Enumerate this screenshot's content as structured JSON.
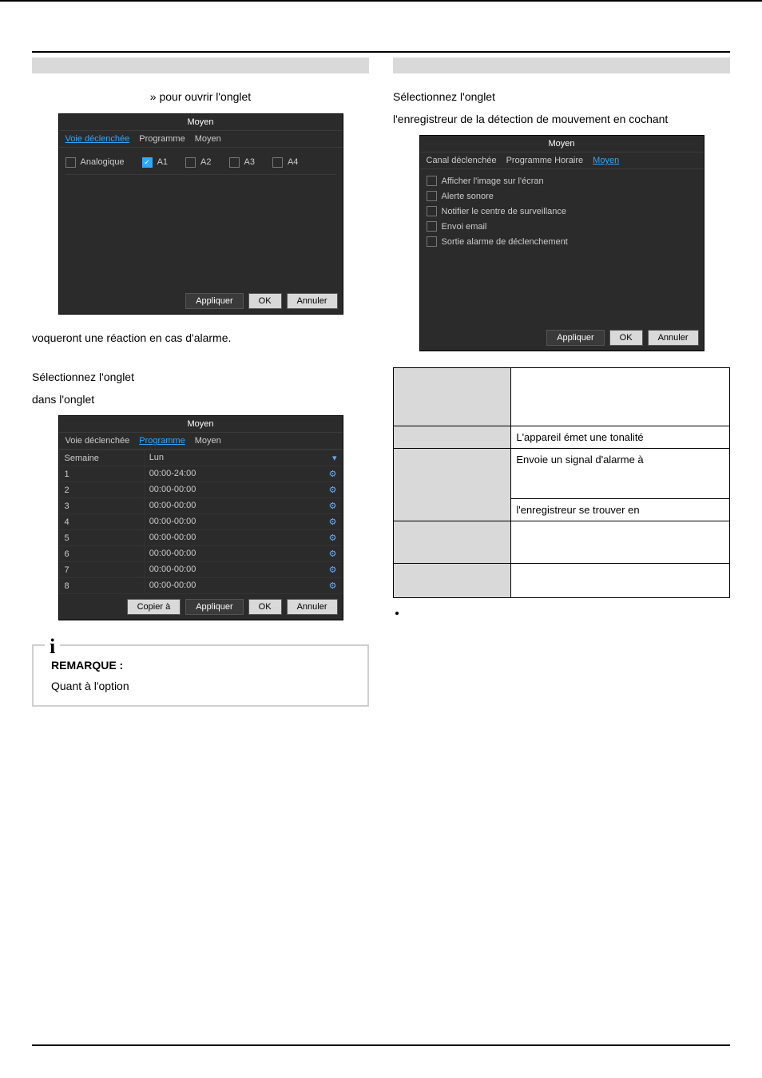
{
  "left": {
    "line1": "» pour ouvrir l'onglet",
    "fig1": {
      "title": "Moyen",
      "tabs": [
        "Voie déclenchée",
        "Programme",
        "Moyen"
      ],
      "activeTab": "Voie déclenchée",
      "row_label": "Analogique",
      "channels": {
        "A1": true,
        "A2": false,
        "A3": false,
        "A4": false
      },
      "buttons": {
        "apply": "Appliquer",
        "ok": "OK",
        "cancel": "Annuler"
      }
    },
    "line2": "voqueront une réaction en cas d'alarme.",
    "line3": "Sélectionnez l'onglet",
    "line4": "dans l'onglet",
    "fig2": {
      "title": "Moyen",
      "tabs": [
        "Voie déclenchée",
        "Programme",
        "Moyen"
      ],
      "activeTab": "Programme",
      "week_label": "Semaine",
      "day": "Lun",
      "rows": [
        {
          "n": "1",
          "t": "00:00-24:00"
        },
        {
          "n": "2",
          "t": "00:00-00:00"
        },
        {
          "n": "3",
          "t": "00:00-00:00"
        },
        {
          "n": "4",
          "t": "00:00-00:00"
        },
        {
          "n": "5",
          "t": "00:00-00:00"
        },
        {
          "n": "6",
          "t": "00:00-00:00"
        },
        {
          "n": "7",
          "t": "00:00-00:00"
        },
        {
          "n": "8",
          "t": "00:00-00:00"
        }
      ],
      "buttons": {
        "copy": "Copier à",
        "apply": "Appliquer",
        "ok": "OK",
        "cancel": "Annuler"
      }
    },
    "note": {
      "title": "REMARQUE :",
      "body": "Quant à l'option"
    }
  },
  "right": {
    "line1": "Sélectionnez l'onglet",
    "line2": "l'enregistreur de la détection de mouvement en cochant",
    "fig3": {
      "title": "Moyen",
      "tabs": [
        "Canal déclenchée",
        "Programme Horaire",
        "Moyen"
      ],
      "activeTab": "Moyen",
      "actions": [
        "Afficher l'image sur l'écran",
        "Alerte sonore",
        "Notifier le centre de surveillance",
        "Envoi email",
        "Sortie alarme de déclenchement"
      ],
      "buttons": {
        "apply": "Appliquer",
        "ok": "OK",
        "cancel": "Annuler"
      }
    },
    "desc": [
      {
        "k": "",
        "v": ""
      },
      {
        "k": "",
        "v": "L'appareil émet une tonalité"
      },
      {
        "k": "",
        "v": "Envoie un signal d'alarme à"
      },
      {
        "k": "",
        "v": "l'enregistreur se trouver en"
      },
      {
        "k": "",
        "v": ""
      },
      {
        "k": "",
        "v": ""
      }
    ]
  }
}
